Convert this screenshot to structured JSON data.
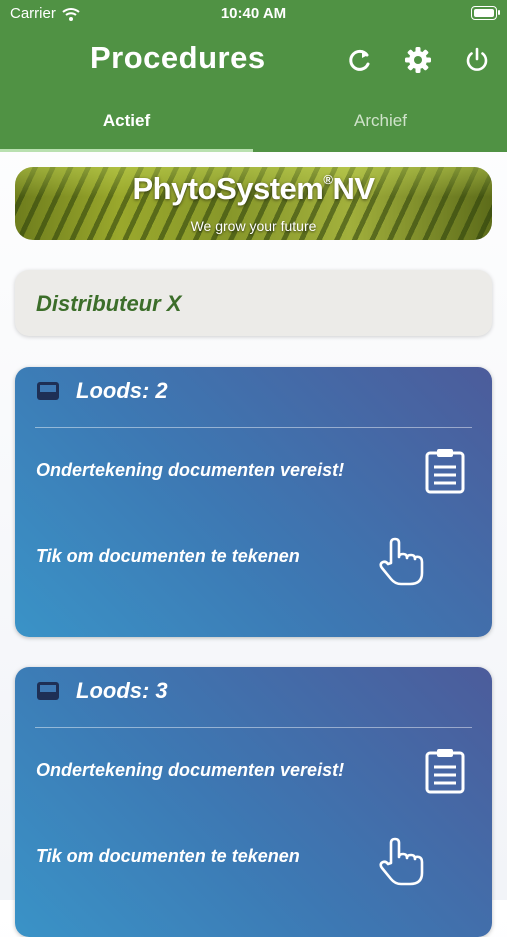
{
  "status_bar": {
    "carrier": "Carrier",
    "time": "10:40 AM"
  },
  "header": {
    "title": "Procedures",
    "icons": [
      "refresh-icon",
      "gear-icon",
      "power-icon"
    ]
  },
  "tabs": [
    {
      "label": "Actief",
      "active": true
    },
    {
      "label": "Archief",
      "active": false
    }
  ],
  "banner": {
    "brand": "PhytoSystem",
    "brand_mark": "®",
    "brand_suffix": "NV",
    "tagline": "We grow your future"
  },
  "distributor": {
    "name": "Distributeur X"
  },
  "cards": [
    {
      "title": "Loods: 2",
      "required_text": "Ondertekening documenten vereist!",
      "action_text": "Tik om documenten te tekenen"
    },
    {
      "title": "Loods: 3",
      "required_text": "Ondertekening documenten vereist!",
      "action_text": "Tik om documenten te tekenen"
    }
  ],
  "colors": {
    "header": "#509244",
    "card_start": "#3a93c7",
    "card_end": "#4c5c9b",
    "distributor_text": "#3c6e2a"
  }
}
